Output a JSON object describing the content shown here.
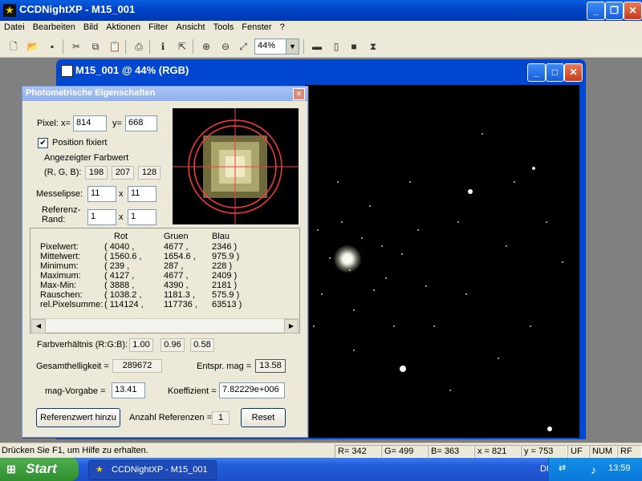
{
  "app": {
    "title": "CCDNightXP - M15_001"
  },
  "menu": [
    "Datei",
    "Bearbeiten",
    "Bild",
    "Aktionen",
    "Filter",
    "Ansicht",
    "Tools",
    "Fenster",
    "?"
  ],
  "toolbar": {
    "zoom": "44%"
  },
  "child_window": {
    "title": "M15_001 @ 44% (RGB)"
  },
  "dialog": {
    "title": "Photometrische Eigenschaften",
    "pixel_label": "Pixel: x=",
    "pixel_x": "814",
    "y_label": "y=",
    "pixel_y": "668",
    "position_fixed_label": "Position fixiert",
    "position_fixed_checked": true,
    "displayed_color_label": "Angezeigter Farbwert",
    "rgb_label": "(R, G, B):",
    "rgb": [
      "198",
      "207",
      "128"
    ],
    "measure_ellipse_label": "Messelipse:",
    "measure_x": "11",
    "measure_y": "11",
    "ref_edge_label1": "Referenz-",
    "ref_edge_label2": "Rand:",
    "ref_x": "1",
    "ref_y": "1",
    "times": "x",
    "stats": {
      "headers": [
        "Rot",
        "Gruen",
        "Blau"
      ],
      "rows": [
        {
          "label": "Pixelwert:",
          "rot": "( 4040 ,",
          "gruen": "4677 ,",
          "blau": "2346   )"
        },
        {
          "label": "Mittelwert:",
          "rot": "( 1560.6 ,",
          "gruen": "1654.6 ,",
          "blau": "975.9   )"
        },
        {
          "label": "Minimum:",
          "rot": "( 239 ,",
          "gruen": "287 ,",
          "blau": "228   )"
        },
        {
          "label": "Maximum:",
          "rot": "( 4127 ,",
          "gruen": "4677 ,",
          "blau": "2409   )"
        },
        {
          "label": "Max-Min:",
          "rot": "( 3888 ,",
          "gruen": "4390 ,",
          "blau": "2181   )"
        },
        {
          "label": "Rauschen:",
          "rot": "( 1038.2 ,",
          "gruen": "1181.3 ,",
          "blau": "575.9   )"
        },
        {
          "label": "rel.Pixelsumme:",
          "rot": "( 114124 ,",
          "gruen": "117736 ,",
          "blau": "63513   )"
        }
      ]
    },
    "color_ratio_label": "Farbverhältnis (R:G:B):",
    "color_ratio": [
      "1.00",
      "0.96",
      "0.58"
    ],
    "total_brightness_label": "Gesamthelligkeit =",
    "total_brightness": "289672",
    "equiv_mag_label": "Entspr. mag =",
    "equiv_mag": "13.58",
    "mag_preset_label": "mag-Vorgabe =",
    "mag_preset": "13.41",
    "coefficient_label": "Koeffizient =",
    "coefficient": "7.82229e+006",
    "add_ref_button": "Referenzwert hinzu",
    "ref_count_label": "Anzahl Referenzen =",
    "ref_count": "1",
    "reset_button": "Reset"
  },
  "statusbar": {
    "help": "Drücken Sie F1, um Hilfe zu erhalten.",
    "r": "R= 342",
    "g": "G= 499",
    "b": "B= 363",
    "x": "x = 821",
    "y": "y = 753",
    "uf": "UF",
    "num": "NUM",
    "rf": "RF"
  },
  "taskbar": {
    "start": "Start",
    "task": "CCDNightXP - M15_001",
    "lang": "DE",
    "time": "13:59"
  }
}
